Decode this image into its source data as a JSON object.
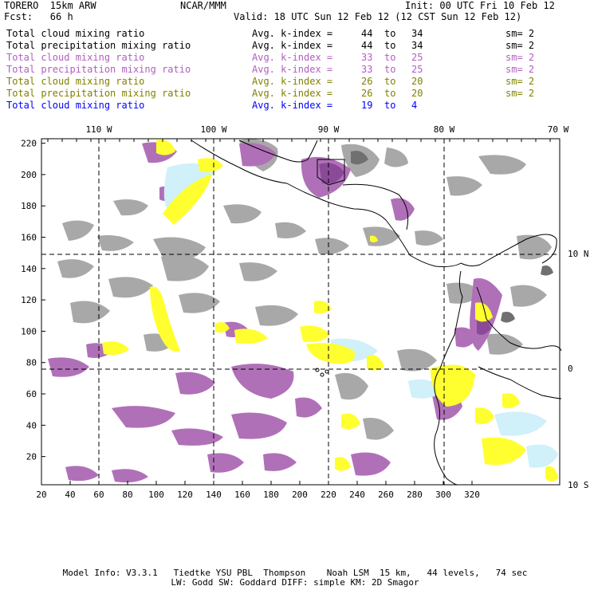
{
  "header": {
    "model": "TORERO  15km ARW",
    "org": "NCAR/MMM",
    "init": "Init: 00 UTC Fri 10 Feb 12",
    "fcst": "Fcst:   66 h",
    "valid": "Valid: 18 UTC Sun 12 Feb 12 (12 CST Sun 12 Feb 12)"
  },
  "legend": [
    {
      "name": "Total cloud mixing ratio",
      "kidx": "Avg. k-index =",
      "from": "44",
      "to_word": "to",
      "to": "34",
      "sm": "sm= 2",
      "color": "#000000"
    },
    {
      "name": "Total precipitation mixing ratio",
      "kidx": "Avg. k-index =",
      "from": "44",
      "to_word": "to",
      "to": "34",
      "sm": "sm= 2",
      "color": "#000000"
    },
    {
      "name": "Total cloud mixing ratio",
      "kidx": "Avg. k-index =",
      "from": "33",
      "to_word": "to",
      "to": "25",
      "sm": "sm= 2",
      "color": "#b060c0"
    },
    {
      "name": "Total precipitation mixing ratio",
      "kidx": "Avg. k-index =",
      "from": "33",
      "to_word": "to",
      "to": "25",
      "sm": "sm= 2",
      "color": "#b060c0"
    },
    {
      "name": "Total cloud mixing ratio",
      "kidx": "Avg. k-index =",
      "from": "26",
      "to_word": "to",
      "to": "20",
      "sm": "sm= 2",
      "color": "#808000"
    },
    {
      "name": "Total precipitation mixing ratio",
      "kidx": "Avg. k-index =",
      "from": "26",
      "to_word": "to",
      "to": "20",
      "sm": "sm= 2",
      "color": "#808000"
    },
    {
      "name": "Total cloud mixing ratio",
      "kidx": "Avg. k-index =",
      "from": "19",
      "to_word": "to",
      "to": "4",
      "sm": "",
      "color": "#0000ff"
    }
  ],
  "map": {
    "lon_labels": [
      "110 W",
      "100 W",
      "90 W",
      "80 W",
      "70 W"
    ],
    "lat_labels": [
      "10 N",
      "0",
      "10 S"
    ],
    "x_ticks": [
      "20",
      "40",
      "60",
      "80",
      "100",
      "120",
      "140",
      "160",
      "180",
      "200",
      "220",
      "240",
      "260",
      "280",
      "300",
      "320"
    ],
    "y_ticks": [
      "20",
      "40",
      "60",
      "80",
      "100",
      "120",
      "140",
      "160",
      "180",
      "200",
      "220"
    ],
    "fill_colors": {
      "gray": "#a8a8a8",
      "dark_gray": "#707070",
      "purple": "#b070b8",
      "dark_purple": "#8a4a98",
      "yellow": "#ffff30",
      "light_blue": "#d0f0fa"
    }
  },
  "footer": {
    "line1": "Model Info: V3.3.1   Tiedtke YSU PBL  Thompson    Noah LSM  15 km,   44 levels,   74 sec",
    "line2": "LW: Godd SW: Goddard DIFF: simple KM: 2D Smagor"
  }
}
